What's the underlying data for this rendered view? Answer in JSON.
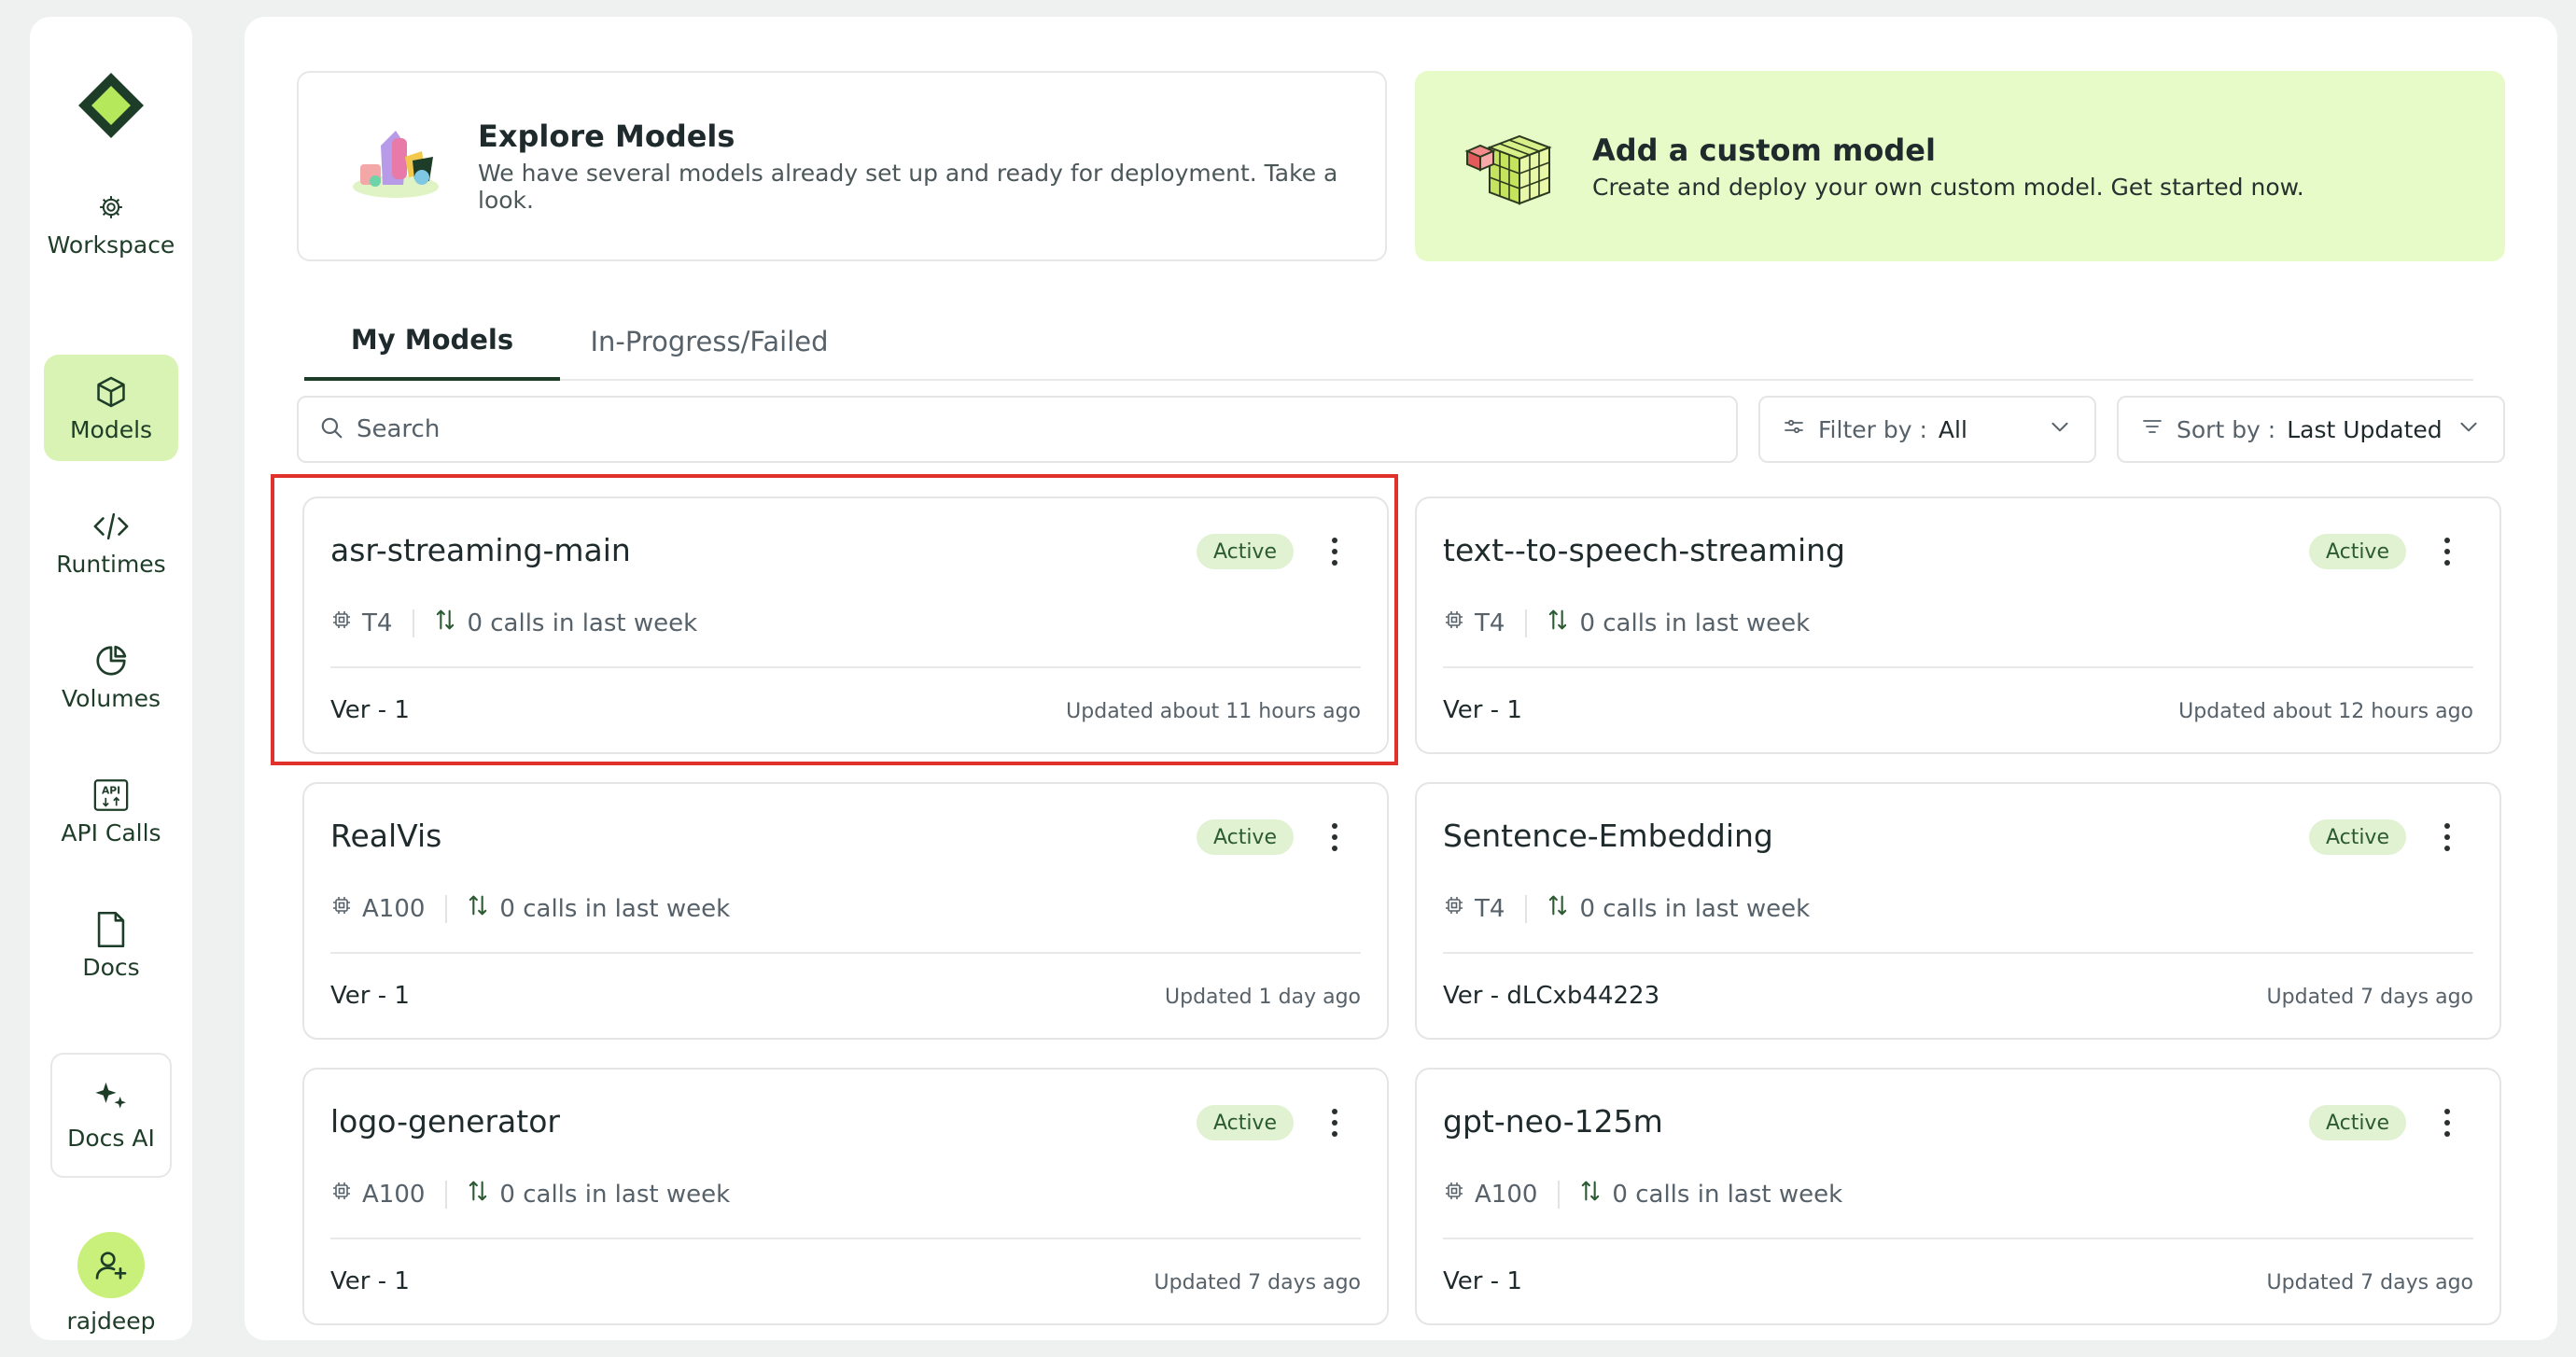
{
  "sidebar": {
    "workspace_label": "Workspace",
    "items": [
      {
        "label": "Models",
        "icon": "cube-icon",
        "active": true
      },
      {
        "label": "Runtimes",
        "icon": "code-icon"
      },
      {
        "label": "Volumes",
        "icon": "pie-chart-icon"
      },
      {
        "label": "API Calls",
        "icon": "api-icon"
      },
      {
        "label": "Docs",
        "icon": "document-icon"
      }
    ],
    "docs_ai_label": "Docs AI",
    "user_name": "rajdeep"
  },
  "banners": {
    "explore": {
      "title": "Explore Models",
      "subtitle": "We have several models already set up and ready for deployment. Take a look."
    },
    "custom": {
      "title": "Add a custom model",
      "subtitle": "Create and deploy your own custom model. Get started now."
    }
  },
  "tabs": [
    {
      "label": "My Models",
      "active": true
    },
    {
      "label": "In-Progress/Failed",
      "active": false
    }
  ],
  "search": {
    "placeholder": "Search"
  },
  "filter": {
    "label": "Filter by :",
    "value": "All"
  },
  "sort": {
    "label": "Sort by :",
    "value": "Last Updated"
  },
  "models": [
    {
      "name": "asr-streaming-main",
      "status": "Active",
      "gpu": "T4",
      "calls": "0 calls in last week",
      "version": "Ver - 1",
      "updated": "Updated about 11 hours ago"
    },
    {
      "name": "text--to-speech-streaming",
      "status": "Active",
      "gpu": "T4",
      "calls": "0 calls in last week",
      "version": "Ver - 1",
      "updated": "Updated about 12 hours ago"
    },
    {
      "name": "RealVis",
      "status": "Active",
      "gpu": "A100",
      "calls": "0 calls in last week",
      "version": "Ver - 1",
      "updated": "Updated 1 day ago"
    },
    {
      "name": "Sentence-Embedding",
      "status": "Active",
      "gpu": "T4",
      "calls": "0 calls in last week",
      "version": "Ver - dLCxb44223",
      "updated": "Updated 7 days ago"
    },
    {
      "name": "logo-generator",
      "status": "Active",
      "gpu": "A100",
      "calls": "0 calls in last week",
      "version": "Ver - 1",
      "updated": "Updated 7 days ago"
    },
    {
      "name": "gpt-neo-125m",
      "status": "Active",
      "gpu": "A100",
      "calls": "0 calls in last week",
      "version": "Ver - 1",
      "updated": "Updated 7 days ago"
    }
  ],
  "colors": {
    "accent_dark": "#1e3d28",
    "accent_light": "#d9f3b4",
    "badge_bg": "#e1f2d2",
    "highlight": "#e0312a"
  }
}
